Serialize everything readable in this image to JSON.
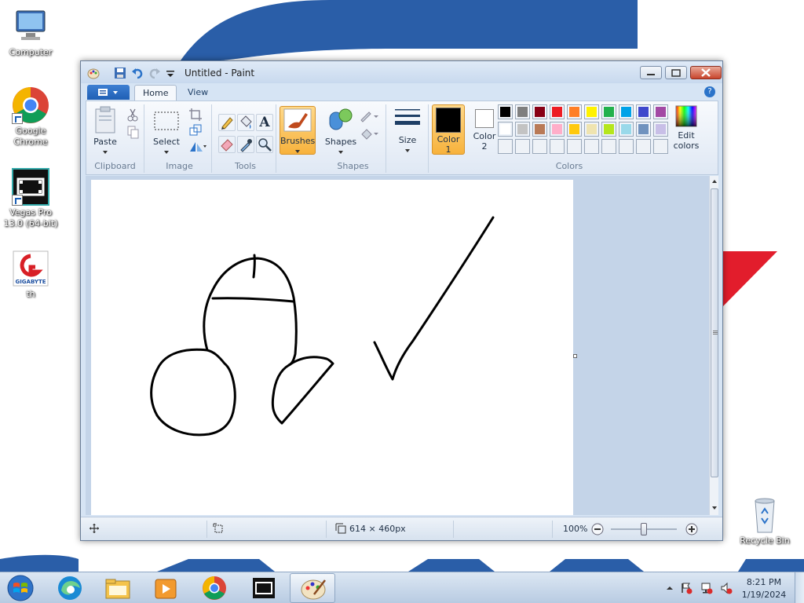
{
  "desktop": {
    "icons": [
      {
        "label": "Computer",
        "icon": "computer-icon"
      },
      {
        "label": "Google Chrome",
        "icon": "chrome-icon"
      },
      {
        "label": "Vegas Pro 13.0 (64-bit)",
        "icon": "vegas-icon"
      },
      {
        "label": "th",
        "icon": "gigabyte-icon"
      },
      {
        "label": "Recycle Bin",
        "icon": "recycle-bin-icon"
      }
    ],
    "gigabyte_text": "GIGABYTE"
  },
  "window": {
    "title": "Untitled - Paint",
    "tabs": [
      {
        "label": "Home"
      },
      {
        "label": "View"
      }
    ],
    "help": "?"
  },
  "ribbon": {
    "clipboard": {
      "paste": "Paste",
      "group": "Clipboard"
    },
    "image": {
      "select": "Select",
      "group": "Image"
    },
    "tools": {
      "group": "Tools",
      "text_tool": "A"
    },
    "brushes": {
      "label": "Brushes"
    },
    "shapes": {
      "label": "Shapes",
      "group": "Shapes"
    },
    "size": {
      "label": "Size"
    },
    "color1": {
      "label": "Color",
      "num": "1"
    },
    "color2": {
      "label": "Color",
      "num": "2"
    },
    "colors_group": "Colors",
    "edit_colors": {
      "label1": "Edit",
      "label2": "colors"
    },
    "palette_row1": [
      "#000000",
      "#7f7f7f",
      "#880015",
      "#ed1c24",
      "#ff7f27",
      "#fff200",
      "#22b14c",
      "#00a2e8",
      "#3f48cc",
      "#a349a4"
    ],
    "palette_row2": [
      "#ffffff",
      "#c3c3c3",
      "#b97a57",
      "#ffaec9",
      "#ffc90e",
      "#efe4b0",
      "#b5e61d",
      "#99d9ea",
      "#7092be",
      "#c8bfe7"
    ],
    "color1_value": "#000000",
    "color2_value": "#ffffff"
  },
  "status": {
    "dimensions": "614 × 460px",
    "zoom": "100%"
  },
  "taskbar": {
    "time": "8:21 PM",
    "date": "1/19/2024"
  }
}
